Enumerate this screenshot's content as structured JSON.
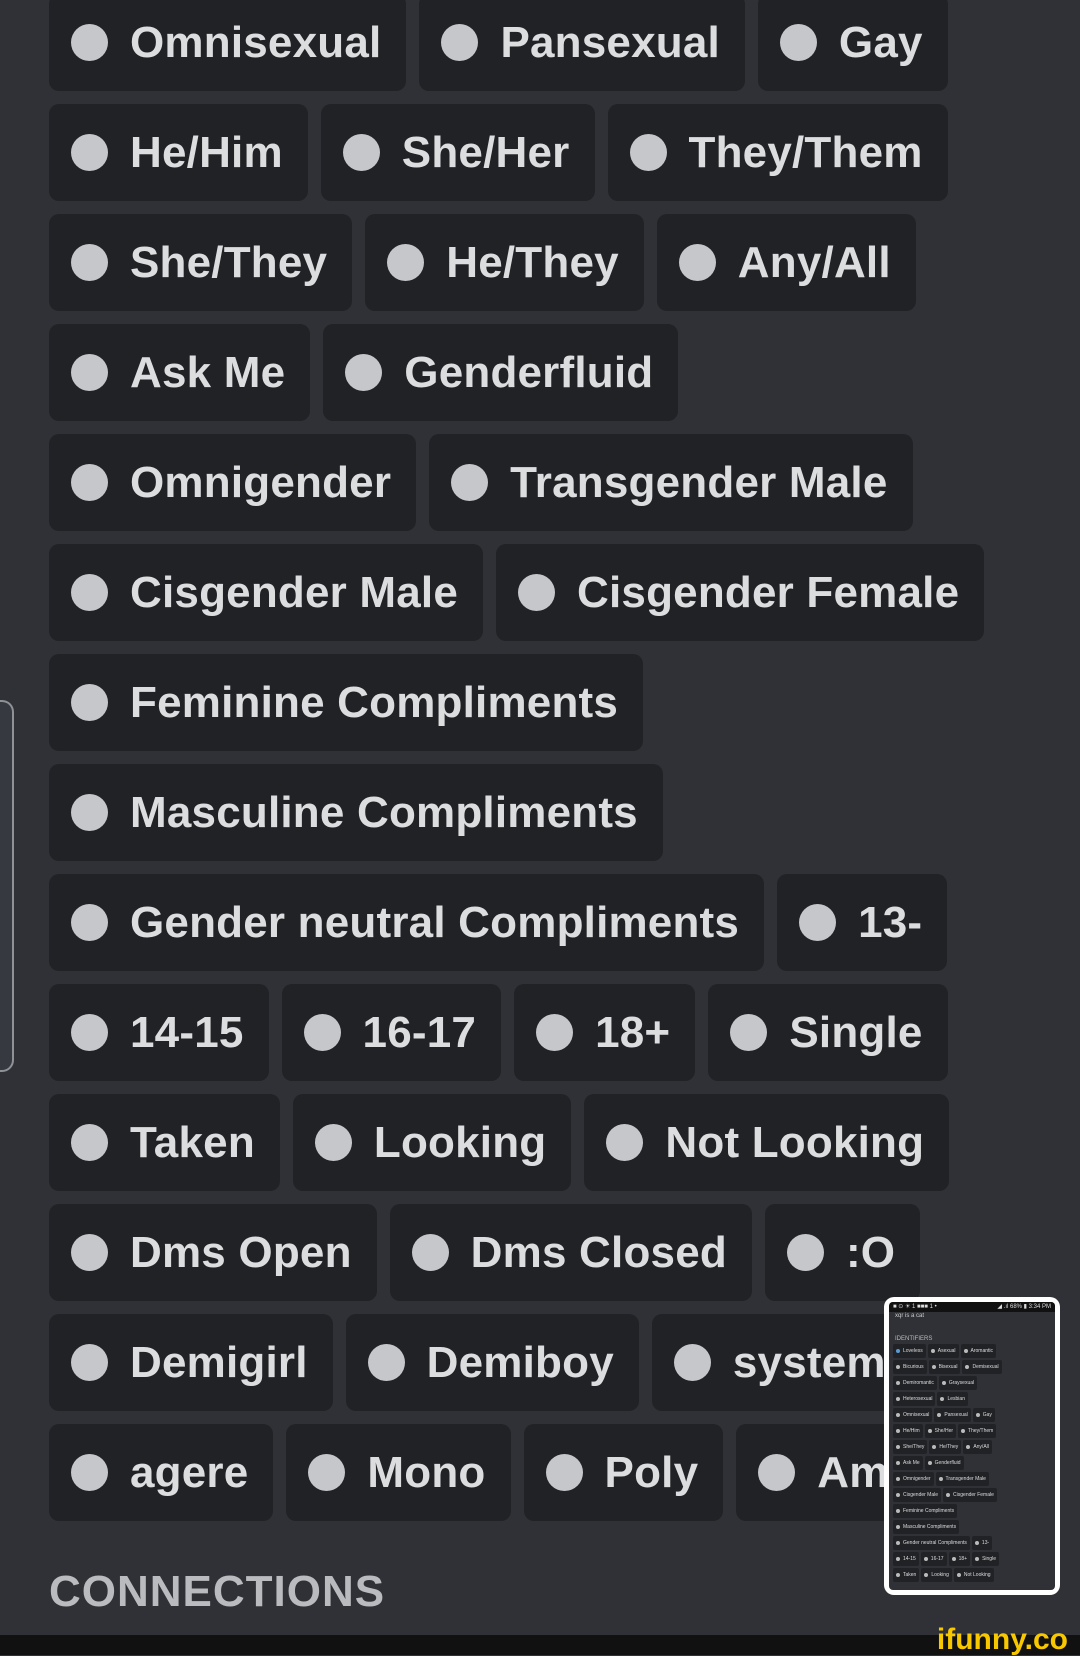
{
  "roles": {
    "rows": [
      [
        "Omnisexual",
        "Pansexual",
        "Gay"
      ],
      [
        "He/Him",
        "She/Her",
        "They/Them"
      ],
      [
        "She/They",
        "He/They",
        "Any/All"
      ],
      [
        "Ask Me",
        "Genderfluid"
      ],
      [
        "Omnigender",
        "Transgender Male"
      ],
      [
        "Cisgender Male",
        "Cisgender Female"
      ],
      [
        "Feminine Compliments"
      ],
      [
        "Masculine Compliments"
      ],
      [
        "Gender neutral Compliments",
        "13-"
      ],
      [
        "14-15",
        "16-17",
        "18+",
        "Single"
      ],
      [
        "Taken",
        "Looking",
        "Not Looking"
      ],
      [
        "Dms Open",
        "Dms Closed",
        ":O"
      ],
      [
        "Demigirl",
        "Demiboy",
        "system"
      ],
      [
        "agere",
        "Mono",
        "Poly",
        "Aml"
      ]
    ],
    "dot_color": "#c5c7cb",
    "pill_color": "#202225"
  },
  "connections": {
    "heading": "CONNECTIONS"
  },
  "watermark": {
    "text": "ifunny.co",
    "color": "#f7c700"
  },
  "thumbnail": {
    "status_left": "■ ⊙ ☀ 1 ■■■ 1 •",
    "status_right": "◢ .ıl 68% ▮ 3:34 PM",
    "title": "xqr is a cat",
    "heading": "IDENTIFIERS",
    "rows": [
      [
        "Loveless",
        "Asexual",
        "Aromantic"
      ],
      [
        "Bicurious",
        "Bisexual",
        "Demisexual"
      ],
      [
        "Demiromantic",
        "Graysexual"
      ],
      [
        "Heterosexual",
        "Lesbian"
      ],
      [
        "Omnisexual",
        "Pansexual",
        "Gay"
      ],
      [
        "He/Him",
        "She/Her",
        "They/Them"
      ],
      [
        "She/They",
        "He/They",
        "Any/All"
      ],
      [
        "Ask Me",
        "Genderfluid"
      ],
      [
        "Omnigender",
        "Transgender Male"
      ],
      [
        "Cisgender Male",
        "Cisgender Female"
      ],
      [
        "Feminine Compliments"
      ],
      [
        "Masculine Compliments"
      ],
      [
        "Gender neutral Compliments",
        "13-"
      ],
      [
        "14-15",
        "16-17",
        "18+",
        "Single"
      ],
      [
        "Taken",
        "Looking",
        "Not Looking"
      ]
    ]
  }
}
